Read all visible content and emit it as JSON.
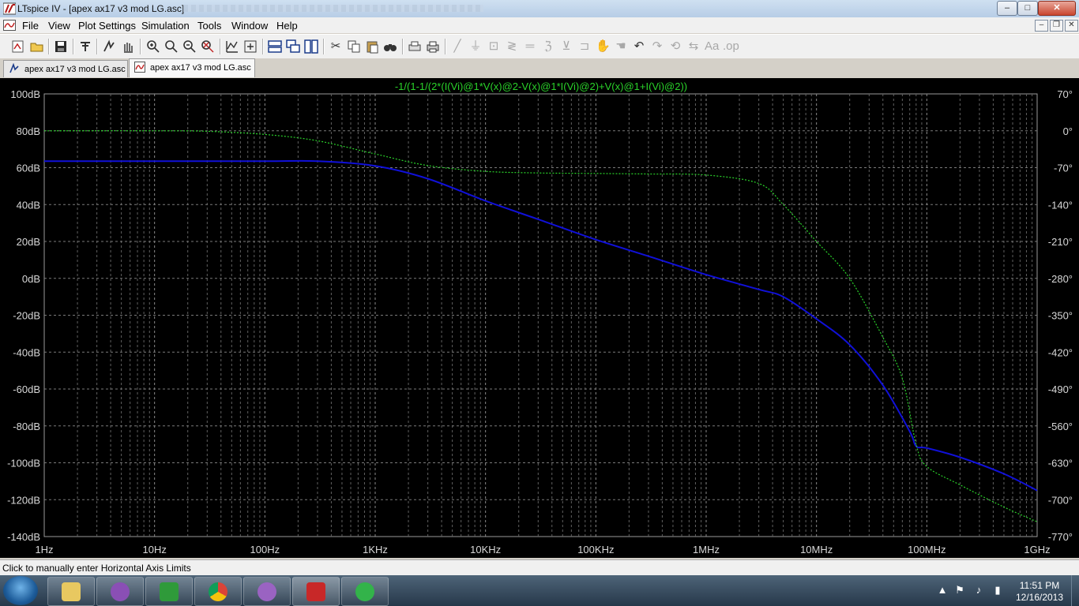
{
  "window": {
    "title": "LTspice IV - [apex ax17 v3 mod LG.asc]",
    "controls": {
      "minimize": "–",
      "maximize": "□",
      "close": "✕"
    }
  },
  "menu": {
    "items": [
      {
        "label": "File"
      },
      {
        "label": "View"
      },
      {
        "label": "Plot Settings"
      },
      {
        "label": "Simulation"
      },
      {
        "label": "Tools"
      },
      {
        "label": "Window"
      },
      {
        "label": "Help"
      }
    ],
    "mdi_controls": {
      "minimize": "–",
      "restore": "❐",
      "close": "✕"
    }
  },
  "toolbar": {
    "icons": [
      "new-schematic-icon",
      "open-icon",
      "save-icon",
      "control-panel-icon",
      "run-icon",
      "halt-icon",
      "zoom-in-icon",
      "zoom-area-icon",
      "zoom-out-icon",
      "zoom-fit-icon",
      "autorange-icon",
      "mark-icon",
      "tile-horizontal-icon",
      "cascade-icon",
      "tile-vertical-icon",
      "cut-icon",
      "copy-icon",
      "paste-icon",
      "find-icon",
      "print-setup-icon",
      "print-icon",
      "wire-icon",
      "ground-icon",
      "label-icon",
      "resistor-icon",
      "capacitor-icon",
      "inductor-icon",
      "diode-icon",
      "component-icon",
      "move-icon",
      "drag-icon",
      "undo-icon",
      "redo-icon",
      "rotate-icon",
      "mirror-icon",
      "text-icon",
      "spice-directive-icon"
    ]
  },
  "tabs": [
    {
      "label": "apex ax17 v3 mod LG.asc",
      "kind": "schematic",
      "active": false
    },
    {
      "label": "apex ax17 v3 mod LG.asc",
      "kind": "waveform",
      "active": true
    }
  ],
  "status": {
    "text": "Click to manually enter Horizontal Axis Limits"
  },
  "taskbar": {
    "apps": [
      "explorer-icon",
      "yahoo-messenger-icon",
      "music-app-icon",
      "chrome-icon",
      "yahoo-messenger-2-icon",
      "ltspice-icon",
      "settings-app-icon"
    ],
    "clock_time": "11:51 PM",
    "clock_date": "12/16/2013"
  },
  "colors": {
    "plot_background": "#000000",
    "magnitude_trace": "#1010d8",
    "phase_trace": "#2ad22a",
    "axis_text": "#d8d8d8",
    "trace_label": "#2ad22a"
  },
  "chart_data": {
    "type": "line",
    "title": "-1/(1-1/(2*(I(Vi)@1*V(x)@2-V(x)@1*I(Vi)@2)+V(x)@1+I(Vi)@2))",
    "x_scale": "log",
    "xlim": [
      1,
      1000000000
    ],
    "x_tick_labels": [
      "1Hz",
      "10Hz",
      "100Hz",
      "1KHz",
      "10KHz",
      "100KHz",
      "1MHz",
      "10MHz",
      "100MHz",
      "1GHz"
    ],
    "y_left_unit": "dB",
    "ylim_left": [
      -140,
      100
    ],
    "y_left_tick_labels": [
      "100dB",
      "80dB",
      "60dB",
      "40dB",
      "20dB",
      "0dB",
      "-20dB",
      "-40dB",
      "-60dB",
      "-80dB",
      "-100dB",
      "-120dB",
      "-140dB"
    ],
    "y_right_unit": "degrees",
    "ylim_right": [
      -770,
      70
    ],
    "y_right_tick_labels": [
      "70°",
      "0°",
      "-70°",
      "-140°",
      "-210°",
      "-280°",
      "-350°",
      "-420°",
      "-490°",
      "-560°",
      "-630°",
      "-700°",
      "-770°"
    ],
    "grid": true,
    "series": [
      {
        "axis": "left",
        "style": "solid",
        "x": [
          1,
          10,
          100,
          300,
          1000,
          3000,
          10000,
          30000,
          100000,
          300000,
          1000000,
          3000000,
          5000000,
          10000000,
          20000000,
          40000000,
          70000000,
          80000000,
          100000000,
          200000000,
          500000000,
          1000000000
        ],
        "y": [
          63.5,
          63.5,
          63.5,
          63.5,
          61,
          54,
          42,
          32,
          21,
          12,
          2,
          -6,
          -10,
          -22,
          -36,
          -58,
          -83,
          -91,
          -92,
          -97,
          -106,
          -115
        ]
      },
      {
        "axis": "right",
        "style": "dotted",
        "x": [
          1,
          10,
          30,
          100,
          300,
          1000,
          3000,
          10000,
          30000,
          100000,
          300000,
          1000000,
          3000000,
          5000000,
          10000000,
          20000000,
          40000000,
          60000000,
          80000000,
          100000000,
          200000000,
          500000000,
          1000000000
        ],
        "y": [
          0,
          0,
          -1,
          -7,
          -19,
          -44,
          -66,
          -77,
          -80,
          -81,
          -82,
          -84,
          -100,
          -140,
          -210,
          -280,
          -392,
          -470,
          -595,
          -637,
          -672,
          -714,
          -742
        ]
      }
    ]
  }
}
